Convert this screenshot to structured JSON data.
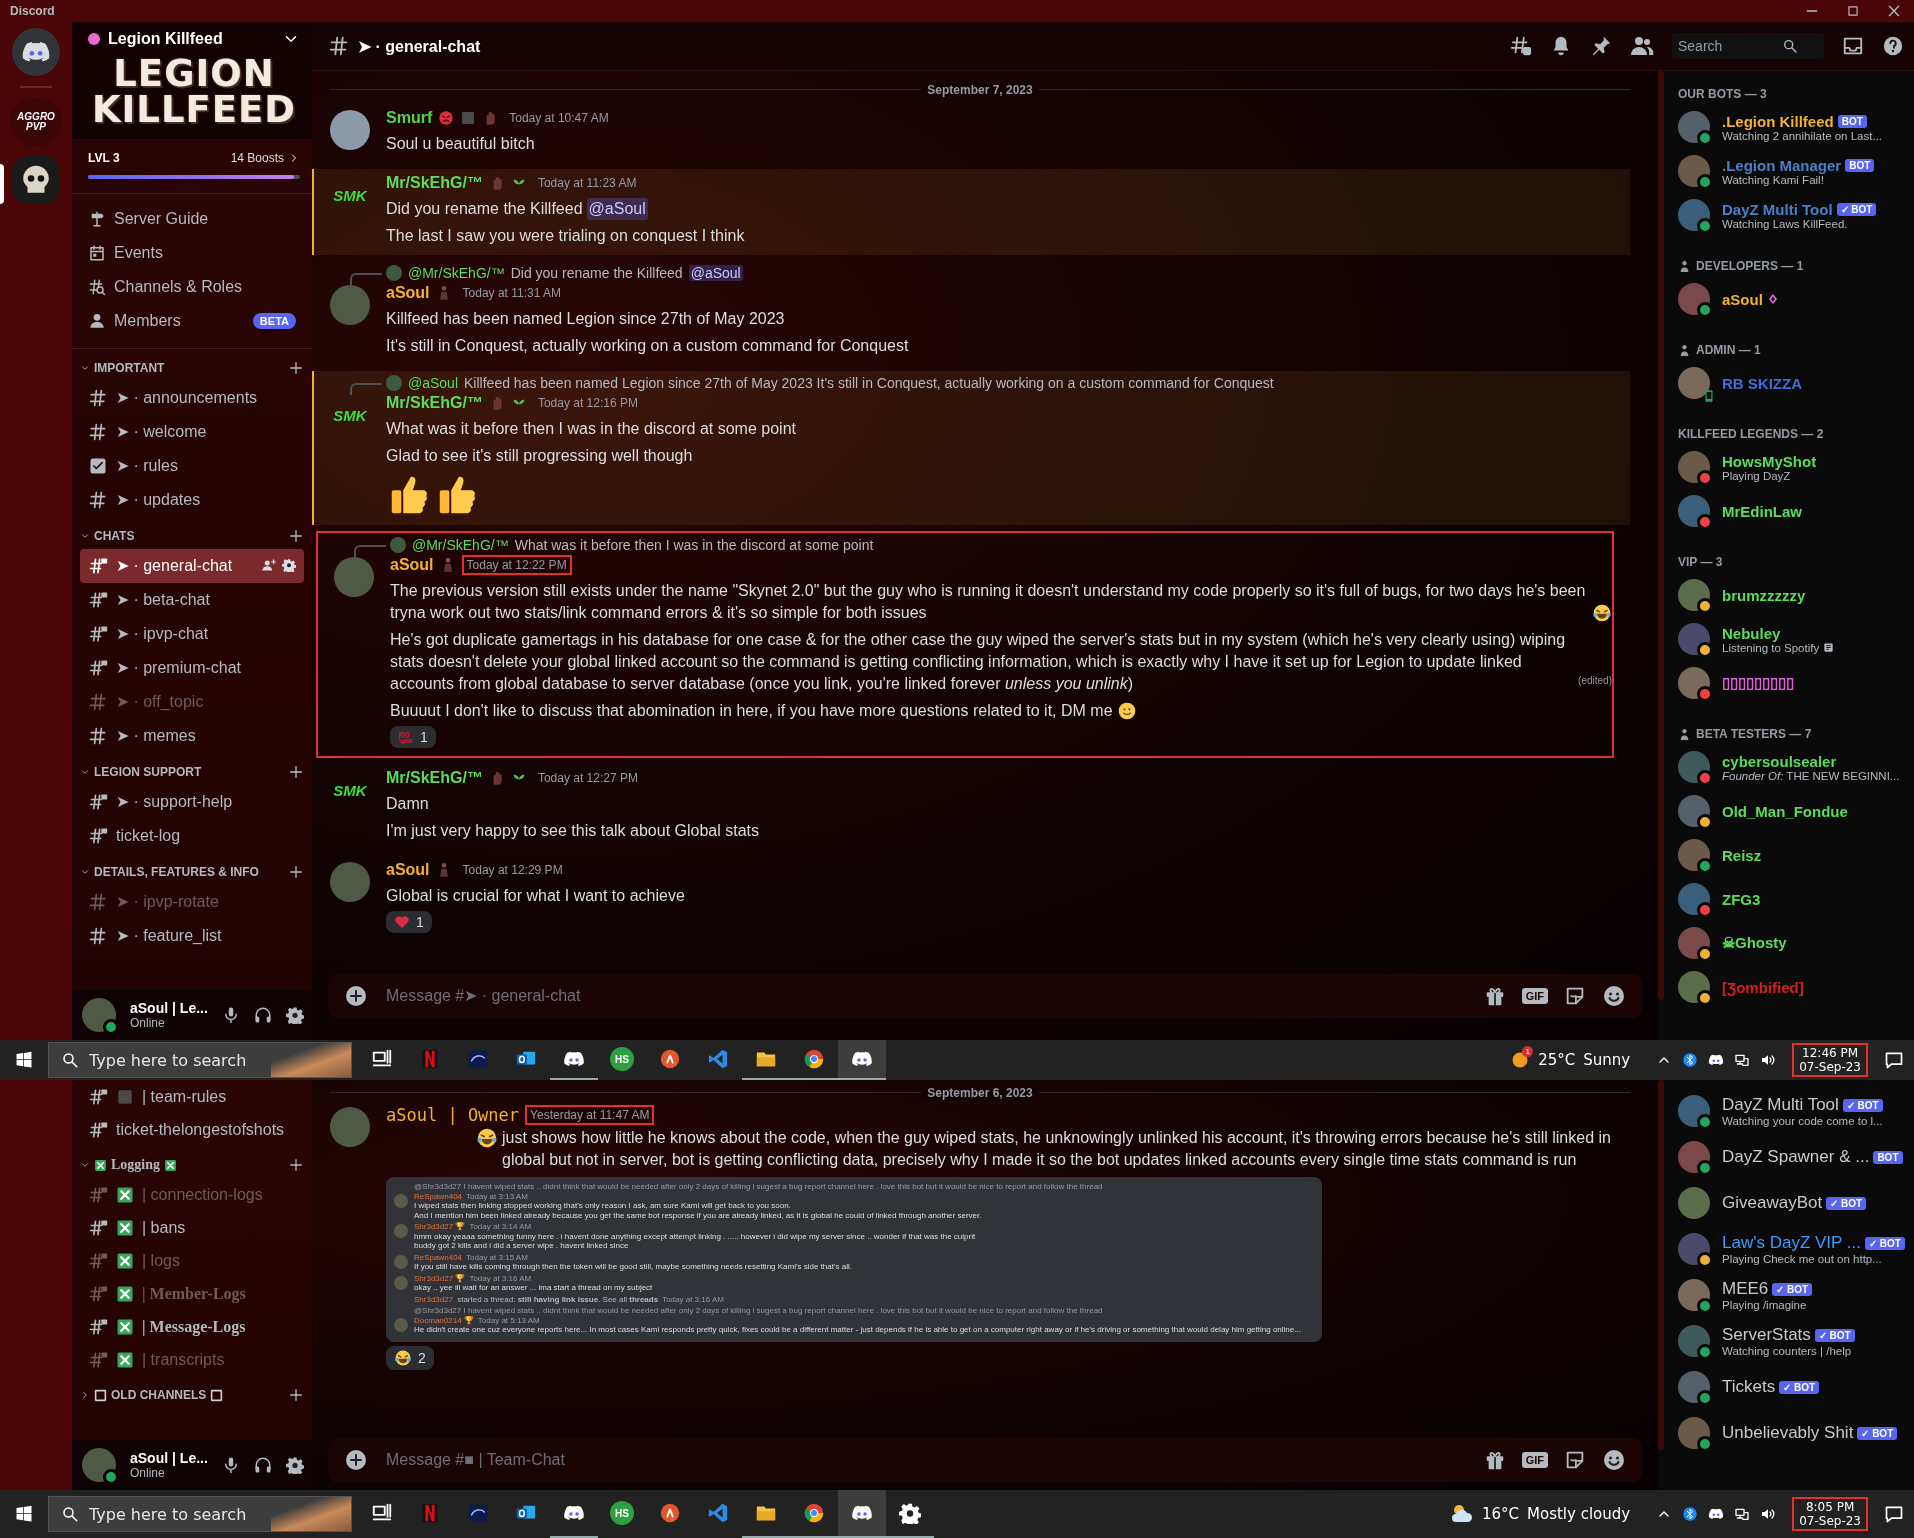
{
  "titlebar": {
    "title": "Discord"
  },
  "top": {
    "rail": [
      {
        "kind": "discord",
        "selected": false
      },
      {
        "kind": "text",
        "label": "AGGRO PVP",
        "selected": false
      },
      {
        "kind": "skull",
        "selected": true
      }
    ],
    "server": {
      "name": "Legion Killfeed",
      "banner": "LEGION KILLFEED",
      "level_label": "LVL 3",
      "boosts": "14 Boosts",
      "level": 0.97
    },
    "menu": [
      {
        "kind": "guide",
        "label": "Server Guide"
      },
      {
        "kind": "events",
        "label": "Events"
      },
      {
        "kind": "roles",
        "label": "Channels & Roles"
      },
      {
        "kind": "members",
        "label": "Members",
        "badge": "BETA"
      }
    ],
    "categories": [
      {
        "name": "IMPORTANT",
        "collapsed": false,
        "channels": [
          {
            "kind": "hash",
            "name": "➤ · announcements",
            "selected": false,
            "muted": false
          },
          {
            "kind": "hash",
            "name": "➤ · welcome",
            "selected": false,
            "muted": false
          },
          {
            "kind": "rules",
            "name": "➤ · rules",
            "selected": false,
            "muted": false
          },
          {
            "kind": "hash",
            "name": "➤ · updates",
            "selected": false,
            "muted": false
          }
        ]
      },
      {
        "name": "CHATS",
        "collapsed": false,
        "channels": [
          {
            "kind": "locked",
            "name": "➤ · general-chat",
            "selected": true,
            "muted": false
          },
          {
            "kind": "locked",
            "name": "➤ · beta-chat",
            "selected": false,
            "muted": false
          },
          {
            "kind": "locked",
            "name": "➤ · ipvp-chat",
            "selected": false,
            "muted": false
          },
          {
            "kind": "locked",
            "name": "➤ · premium-chat",
            "selected": false,
            "muted": false
          },
          {
            "kind": "hash",
            "name": "➤ · off_topic",
            "selected": false,
            "muted": true
          },
          {
            "kind": "hash",
            "name": "➤ · memes",
            "selected": false,
            "muted": false
          }
        ]
      },
      {
        "name": "LEGION SUPPORT",
        "collapsed": false,
        "channels": [
          {
            "kind": "locked",
            "name": "➤ · support-help",
            "selected": false,
            "muted": false
          },
          {
            "kind": "locked",
            "name": "ticket-log",
            "selected": false,
            "muted": false
          }
        ]
      },
      {
        "name": "DETAILS, FEATURES & INFO",
        "collapsed": false,
        "channels": [
          {
            "kind": "hash",
            "name": "➤ · ipvp-rotate",
            "selected": false,
            "muted": true
          },
          {
            "kind": "hash",
            "name": "➤ · feature_list",
            "selected": false,
            "muted": false
          }
        ]
      }
    ],
    "user": {
      "name": "aSoul | **Le...**",
      "status": "Online"
    },
    "header": {
      "channel": "➤ · general-chat",
      "search_placeholder": "Search"
    },
    "date": "September 7, 2023",
    "messages": [
      {
        "kind": "smurf",
        "author": "Smurf",
        "color": "#4fd64f",
        "time": "Today at 10:47 AM",
        "time_outlined": false,
        "highlighted": false,
        "outlined": false,
        "lines": [
          {
            "text": "Soul u beautiful bitch"
          }
        ]
      },
      {
        "kind": "smk",
        "logo": "SMK",
        "author": "Mr/SkEhG/™",
        "color": "#5bdc5b",
        "time": "Today at 11:23 AM",
        "time_outlined": false,
        "highlighted": true,
        "outlined": false,
        "lines": [
          {
            "text": "Did you rename the Killfeed",
            "mention": "@aSoul"
          },
          {
            "text": "The last I saw you were trialing on conquest I think"
          }
        ]
      },
      {
        "reply": {
          "author": "@Mr/SkEhG/™",
          "text": "Did you rename the Killfeed",
          "mention": "@aSoul"
        },
        "kind": "asoul",
        "author": "aSoul",
        "color": "#f0b232",
        "time": "Today at 11:31 AM",
        "time_outlined": false,
        "highlighted": false,
        "outlined": false,
        "lines": [
          {
            "text": "Killfeed has been named Legion since 27th of May 2023"
          },
          {
            "text": "It's still in Conquest, actually working on a custom command for Conquest"
          }
        ]
      },
      {
        "reply": {
          "author": "@aSoul",
          "text": "Killfeed has been named Legion since 27th of May 2023 It's still in Conquest, actually working on a custom command for Conquest"
        },
        "kind": "smk",
        "logo": "SMK",
        "author": "Mr/SkEhG/™",
        "color": "#5bdc5b",
        "time": "Today at 12:16 PM",
        "time_outlined": false,
        "highlighted": true,
        "outlined": false,
        "lines": [
          {
            "text": "What was it before then I was in the discord at some point"
          },
          {
            "text": "Glad to see it's still progressing well though"
          }
        ],
        "big_emoji": [
          {
            "kind": "thumb"
          },
          {
            "kind": "thumb"
          }
        ]
      },
      {
        "reply": {
          "author": "@Mr/SkEhG/™",
          "text": "What was it before then I was in the discord at some point"
        },
        "kind": "asoul",
        "author": "aSoul",
        "color": "#f0b232",
        "time": "Today at 12:22 PM",
        "time_outlined": true,
        "highlighted": false,
        "outlined": true,
        "lines": [
          {
            "text": "The previous version still exists under the name \"Skynet 2.0\" but the guy who is running it doesn't understand my code properly so it's full of bugs, for two days he's been tryna work out two stats/link command errors & it's so simple for both issues",
            "kind": "joy"
          },
          {
            "text": "He's got duplicate gamertags in his database for one case & for the other case the guy wiped the server's stats but in my system (which he's very clearly using) wiping stats doesn't delete your global linked account so the command is getting conflicting information, which is exactly why I have it set up for Legion to update linked accounts from global database to server database (once you link, you're linked forever *unless you unlink*)",
            "edited": "(edited)"
          },
          {
            "text": "Buuuut I don't like to discuss that abomination in here, if you have more questions related to it, DM me",
            "kind": "smile"
          }
        ],
        "reactions": [
          {
            "kind": "hundred",
            "count": "1"
          }
        ]
      },
      {
        "kind": "smk",
        "logo": "SMK",
        "author": "Mr/SkEhG/™",
        "color": "#5bdc5b",
        "time": "Today at 12:27 PM",
        "time_outlined": false,
        "highlighted": false,
        "outlined": false,
        "lines": [
          {
            "text": "Damn"
          },
          {
            "text": "I'm just very happy to see this talk about Global stats"
          }
        ]
      },
      {
        "kind": "asoul",
        "author": "aSoul",
        "color": "#f0b232",
        "time": "Today at 12:29 PM",
        "time_outlined": false,
        "highlighted": false,
        "outlined": false,
        "lines": [
          {
            "text": "Global is crucial for what I want to achieve"
          }
        ],
        "reactions": [
          {
            "kind": "heart",
            "count": "1"
          }
        ]
      }
    ],
    "input_placeholder": "Message #➤ · general-chat",
    "gif_label": "GIF",
    "member_groups": [
      {
        "title": "OUR BOTS — 3",
        "icon": false,
        "members": [
          {
            "name": ".Legion Killfeed",
            "color": "#f0b232",
            "kind": "online",
            "bot": "BOT",
            "activity": "Watching 2 annihilate on Last..."
          },
          {
            "name": ".Legion Manager",
            "color": "#4a7fc9",
            "kind": "online",
            "bot": "BOT",
            "activity": "Watching Kami Fail!"
          },
          {
            "name": "DayZ Multi Tool",
            "color": "#4a7fc9",
            "kind": "online",
            "bot": "✓ BOT",
            "activity": "Watching Laws KillFeed."
          }
        ]
      },
      {
        "title": "DEVELOPERS — 1",
        "icon": true,
        "members": [
          {
            "name": "aSoul",
            "color": "#f0b232",
            "kind": "online",
            "gem": true
          }
        ]
      },
      {
        "title": "ADMIN — 1",
        "icon": true,
        "members": [
          {
            "name": "RB SKIZZA",
            "color": "#3f6fd8",
            "kind": "mobile"
          }
        ]
      },
      {
        "title": "KILLFEED LEGENDS — 2",
        "icon": false,
        "members": [
          {
            "name": "HowsMyShot",
            "color": "#5bdc5b",
            "kind": "dnd",
            "activity": "Playing DayZ"
          },
          {
            "name": "MrEdinLaw",
            "color": "#5bdc5b",
            "kind": "dnd"
          }
        ]
      },
      {
        "title": "VIP — 3",
        "icon": false,
        "members": [
          {
            "name": "brumzzzzzy",
            "color": "#5bdc5b",
            "kind": "idle"
          },
          {
            "name": "Nebuley",
            "color": "#5bdc5b",
            "kind": "idle",
            "activity": "Listening to Spotify",
            "note": true
          },
          {
            "name": "▯▯▯▯▯▯▯▯▯",
            "color": "#e35be3",
            "kind": "dnd"
          }
        ]
      },
      {
        "title": "BETA TESTERS — 7",
        "icon": true,
        "members": [
          {
            "name": "cybersoulsealer",
            "color": "#5bdc5b",
            "kind": "dnd",
            "activity": "*Founder Of:* THE NEW BEGINNI..."
          },
          {
            "name": "Old_Man_Fondue",
            "color": "#5bdc5b",
            "kind": "idle"
          },
          {
            "name": "Reisz",
            "color": "#5bdc5b",
            "kind": "online"
          },
          {
            "name": "ZFG3",
            "color": "#5bdc5b",
            "kind": "dnd"
          },
          {
            "name": "☠Ghosty",
            "color": "#5bdc5b",
            "kind": "idle"
          },
          {
            "name": "[Ʒombified]",
            "color": "#d21f1f",
            "kind": "idle"
          }
        ]
      }
    ]
  },
  "taskbar_top": {
    "search_placeholder": "Type here to search",
    "apps": [
      {
        "kind": "taskview",
        "running": false,
        "active": false
      },
      {
        "kind": "netflix",
        "running": false,
        "active": false
      },
      {
        "kind": "disney",
        "running": false,
        "active": false
      },
      {
        "kind": "outlook",
        "running": false,
        "active": false
      },
      {
        "kind": "discord",
        "running": true,
        "active": false
      },
      {
        "kind": "hs",
        "label": "HS",
        "running": false,
        "active": false
      },
      {
        "kind": "orange",
        "running": false,
        "active": false
      },
      {
        "kind": "vscode",
        "running": false,
        "active": false
      },
      {
        "kind": "folder",
        "running": true,
        "active": false
      },
      {
        "kind": "chrome",
        "running": true,
        "active": false
      },
      {
        "kind": "discord",
        "running": true,
        "active": true
      }
    ],
    "weather": {
      "kind": "sun",
      "temp": "25°C",
      "text": "Sunny",
      "alert": "1"
    },
    "time": "12:46 PM",
    "date": "07-Sep-23"
  },
  "bottom": {
    "channels": [
      {
        "kind": "locked-square",
        "name": "| team-rules",
        "muted": false
      },
      {
        "kind": "locked",
        "name": "ticket-thelongestofshots",
        "muted": false
      }
    ],
    "categories": [
      {
        "name": "Logging",
        "kind": "xbox",
        "collapsed": false,
        "channels": [
          {
            "kind": "locked-xbox",
            "name": "| connection-logs",
            "muted": true
          },
          {
            "kind": "locked-xbox",
            "name": "| bans",
            "muted": false
          },
          {
            "kind": "locked-xbox",
            "name": "| logs",
            "muted": true
          },
          {
            "kind": "locked-xbox",
            "name": "| Member-Logs",
            "muted": true
          },
          {
            "kind": "locked-xbox",
            "name": "| Message-Logs",
            "muted": false
          },
          {
            "kind": "locked-xbox",
            "name": "| transcripts",
            "muted": true
          }
        ]
      },
      {
        "name": "OLD CHANNELS",
        "kind": "square",
        "collapsed": true
      }
    ],
    "user": {
      "name": "aSoul | **Le...**",
      "status": "Online"
    },
    "date": "September 6, 2023",
    "message": {
      "author": "aSoul | Owner",
      "color": "#f0b232",
      "time": "Yesterday at 11:47 AM",
      "kind": "joy",
      "text": "just shows how little he knows about the code, when the guy wiped stats, he unknowingly unlinked his account, it's throwing errors because he's still linked in global but not in server, bot is getting conflicting data, precisely why I made it so the bot updates linked accounts every single time stats command is run",
      "attachment": [
        {
          "reply": "@Shr3d3d27 I havent wiped stats .. didnt think that would be needed after only 2 days of killing i sugest a bug report channel here . love this bot but it would be nice to report and follow the thread",
          "author": "ReSpawn404",
          "time": "Today at 3:13 AM",
          "lines": [
            "I wiped stats then linking stopped working that's only reason I ask, am sure Kami will get back to you soon.",
            "And I mention him been linked already because you get the same bot response if you are already linked, as it is global he could of linked through another server."
          ]
        },
        {
          "author": "Shr3d3d27 🏆",
          "time": "Today at 3:14 AM",
          "lines": [
            "hmm okay yeaaa something funny here . i havent done anything except attempt linking . ..... however i did wipe my server since .. wonder if that was the culprit",
            "buddy got 2 kills and i did a server wipe . havent linked since"
          ]
        },
        {
          "author": "ReSpawn404",
          "time": "Today at 3:15 AM",
          "lines": [
            "If you still have kills coming through then the token will be good still, maybe something needs resetting Kami's side that's all."
          ]
        },
        {
          "author": "Shr3d3d27 🏆",
          "time": "Today at 3:16 AM",
          "lines": [
            "okay .. yee ill wait for an answer ... ima start a thread on my subject"
          ]
        },
        {
          "kind": "thread",
          "author": "Shr3d3d27",
          "text": "started a thread: **still having link issue**. See all **threads**",
          "time": "Today at 3:16 AM"
        },
        {
          "reply": "@Shr3d3d27 I havent wiped stats .. didnt think that would be needed after only 2 days of killing i sugest a bug report channel here . love this bot but it would be nice to report and follow the thread",
          "author": "Docman0214 🏆",
          "time": "Today at 5:13 AM",
          "lines": [
            "He didn't create one cuz everyone reports here... In most cases Kami responds pretty quick, fixes could be a different matter - just depends if he is able to get on a computer right away or if he's driving or something that would delay him getting online..."
          ]
        }
      ],
      "reactions": [
        {
          "kind": "joy",
          "count": "2"
        }
      ]
    },
    "input_placeholder": "Message #■ | Team-Chat",
    "gif_label": "GIF",
    "members": [
      {
        "name": "DayZ Multi Tool",
        "color": "#c9c9c9",
        "kind": "online",
        "bot": "✓ BOT",
        "activity": "Watching your code come to l..."
      },
      {
        "name": "DayZ Spawner & ...",
        "color": "#c9c9c9",
        "kind": "online",
        "bot": "BOT"
      },
      {
        "name": "GiveawayBot",
        "color": "#c9c9c9",
        "kind": "none",
        "bot": "✓ BOT"
      },
      {
        "name": "Law's DayZ VIP ...",
        "color": "#3a9bff",
        "kind": "idle",
        "bot": "✓ BOT",
        "activity": "Playing Check me out on http..."
      },
      {
        "name": "MEE6",
        "color": "#c9c9c9",
        "kind": "online",
        "bot": "✓ BOT",
        "activity": "Playing /imagine"
      },
      {
        "name": "ServerStats",
        "color": "#c9c9c9",
        "kind": "online",
        "bot": "✓ BOT",
        "activity": "Watching counters | /help"
      },
      {
        "name": "Tickets",
        "color": "#c9c9c9",
        "kind": "online",
        "bot": "✓ BOT"
      },
      {
        "name": "Unbelievably Shit",
        "color": "#c9c9c9",
        "kind": "online",
        "bot": "✓ BOT"
      }
    ]
  },
  "taskbar_bottom": {
    "search_placeholder": "Type here to search",
    "apps": [
      {
        "kind": "taskview",
        "running": false,
        "active": false
      },
      {
        "kind": "netflix",
        "running": false,
        "active": false
      },
      {
        "kind": "disney",
        "running": false,
        "active": false
      },
      {
        "kind": "outlook",
        "running": false,
        "active": false
      },
      {
        "kind": "discord",
        "running": true,
        "active": false
      },
      {
        "kind": "hs",
        "label": "HS",
        "running": false,
        "active": false
      },
      {
        "kind": "orange",
        "running": false,
        "active": false
      },
      {
        "kind": "vscode",
        "running": false,
        "active": false
      },
      {
        "kind": "folder",
        "running": true,
        "active": false
      },
      {
        "kind": "chrome",
        "running": true,
        "active": false
      },
      {
        "kind": "discord",
        "running": true,
        "active": true
      },
      {
        "kind": "gear",
        "running": true,
        "active": false
      }
    ],
    "weather": {
      "kind": "cloud",
      "temp": "16°C",
      "text": "Mostly cloudy"
    },
    "time": "8:05 PM",
    "date": "07-Sep-23"
  }
}
